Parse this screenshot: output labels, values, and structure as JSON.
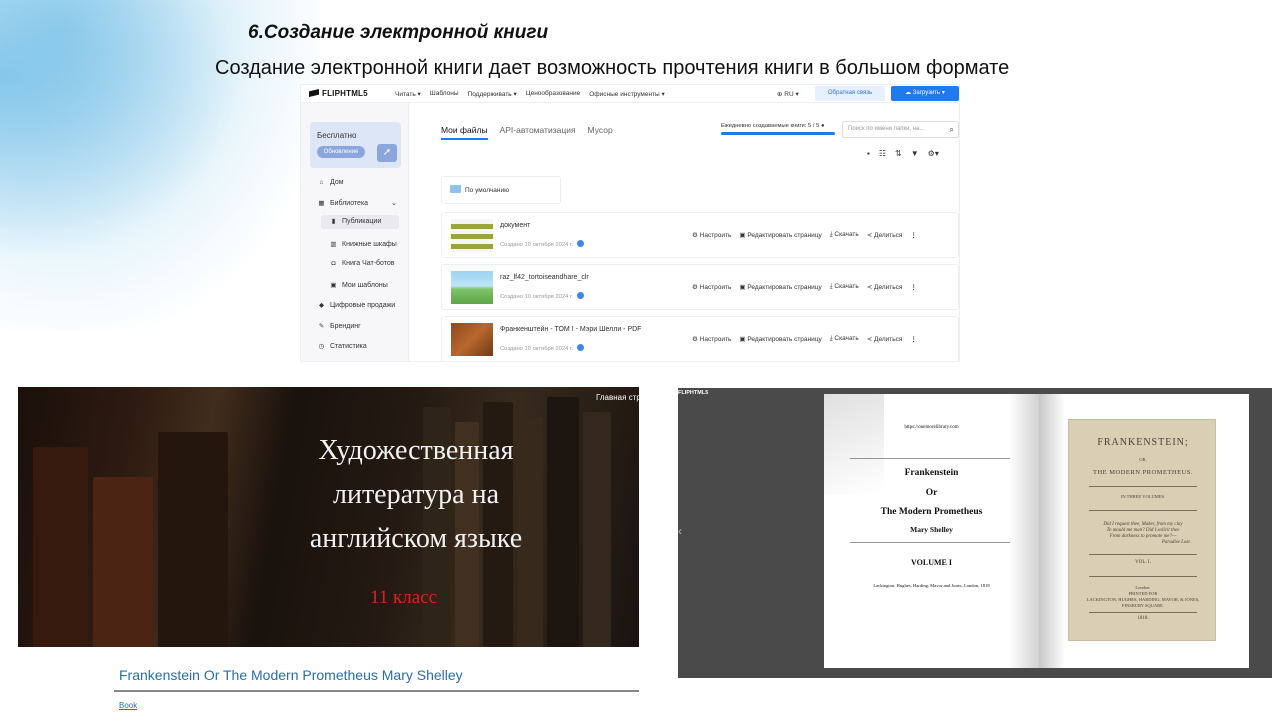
{
  "slide": {
    "title": "6.Создание электронной книги",
    "subtitle": "Создание электронной книги дает возможность прочтения книги в большом формате"
  },
  "app": {
    "logo": "FLIPHTML5",
    "nav": [
      "Читать ▾",
      "Шаблоны",
      "Поддерживать ▾",
      "Ценообразование",
      "Офисные инструменты ▾"
    ],
    "lang": "RU ▾",
    "feedback_label": "Обратная связь",
    "upload_label": "Загрузить",
    "plan": {
      "name": "Бесплатно",
      "upgrade_label": "Обновление"
    },
    "sidebar": [
      {
        "label": "Дом",
        "icon": "home-icon",
        "glyph": "⌂"
      },
      {
        "label": "Библиотека",
        "icon": "library-icon",
        "glyph": "▦",
        "chevron": "⌄"
      },
      {
        "label": "Публикации",
        "icon": "book-icon",
        "glyph": "▮"
      },
      {
        "label": "Книжные шкафы",
        "icon": "shelf-icon",
        "glyph": "▥"
      },
      {
        "label": "Книга Чат-ботов",
        "icon": "chatbot-icon",
        "glyph": "◘"
      },
      {
        "label": "Мои шаблоны",
        "icon": "template-icon",
        "glyph": "▣"
      },
      {
        "label": "Цифровые продажи",
        "icon": "tag-icon",
        "glyph": "◆"
      },
      {
        "label": "Брендинг",
        "icon": "brush-icon",
        "glyph": "✎"
      },
      {
        "label": "Статистика",
        "icon": "stats-icon",
        "glyph": "◷"
      }
    ],
    "tabs": [
      "Мои файлы",
      "API-автоматизация",
      "Мусор"
    ],
    "quota": "Ежедневно создаваемые книги: 5 / 5",
    "search_placeholder": "Поиск по имени папки, на...",
    "folder": "По умолчанию",
    "files": [
      {
        "name": "документ",
        "date": "Создано 10 октября 2024 г."
      },
      {
        "name": "raz_lf42_tortoiseandhare_clr",
        "date": "Создано 10 октября 2024 г."
      },
      {
        "name": "Франкенштейн - ТОМ I - Мэри Шелли - PDF",
        "date": "Создано 10 октября 2024 г."
      }
    ],
    "actions": {
      "settings": "Настроить",
      "edit": "Редактировать страницу",
      "download": "Скачать",
      "share": "Делиться"
    }
  },
  "cover": {
    "nav_link": "Главная стр",
    "title_lines": [
      "Художественная",
      "литература на",
      "английском языке"
    ],
    "grade": "11 класс",
    "page_title": "Frankenstein Or The Modern Prometheus Mary Shelley",
    "link": "Book"
  },
  "reader": {
    "logo": "FLIPHTML5",
    "left_page": {
      "url": "https://onemorelibrary.com",
      "title1": "Frankenstein",
      "title2": "Or",
      "title3": "The Modern Prometheus",
      "author": "Mary Shelley",
      "volume": "VOLUME I",
      "publisher": "Lackington, Hughes, Harding, Mavor and Jones, London, 1818"
    },
    "right_page": {
      "line1": "FRANKENSTEIN;",
      "line2": "OR,",
      "line3": "THE MODERN PROMETHEUS.",
      "line4": "IN THREE VOLUMES.",
      "quote1": "Did I request thee, Maker, from my clay",
      "quote2": "To mould me man? Did I solicit thee",
      "quote3": "From darkness to promote me?—",
      "quote4": "Paradise Lost.",
      "vol": "VOL. I.",
      "imprint1": "London:",
      "imprint2": "PRINTED FOR",
      "imprint3": "LACKINGTON, HUGHES, HARDING, MAVOR, & JONES,",
      "imprint4": "FINSBURY SQUARE.",
      "year": "1818."
    }
  }
}
